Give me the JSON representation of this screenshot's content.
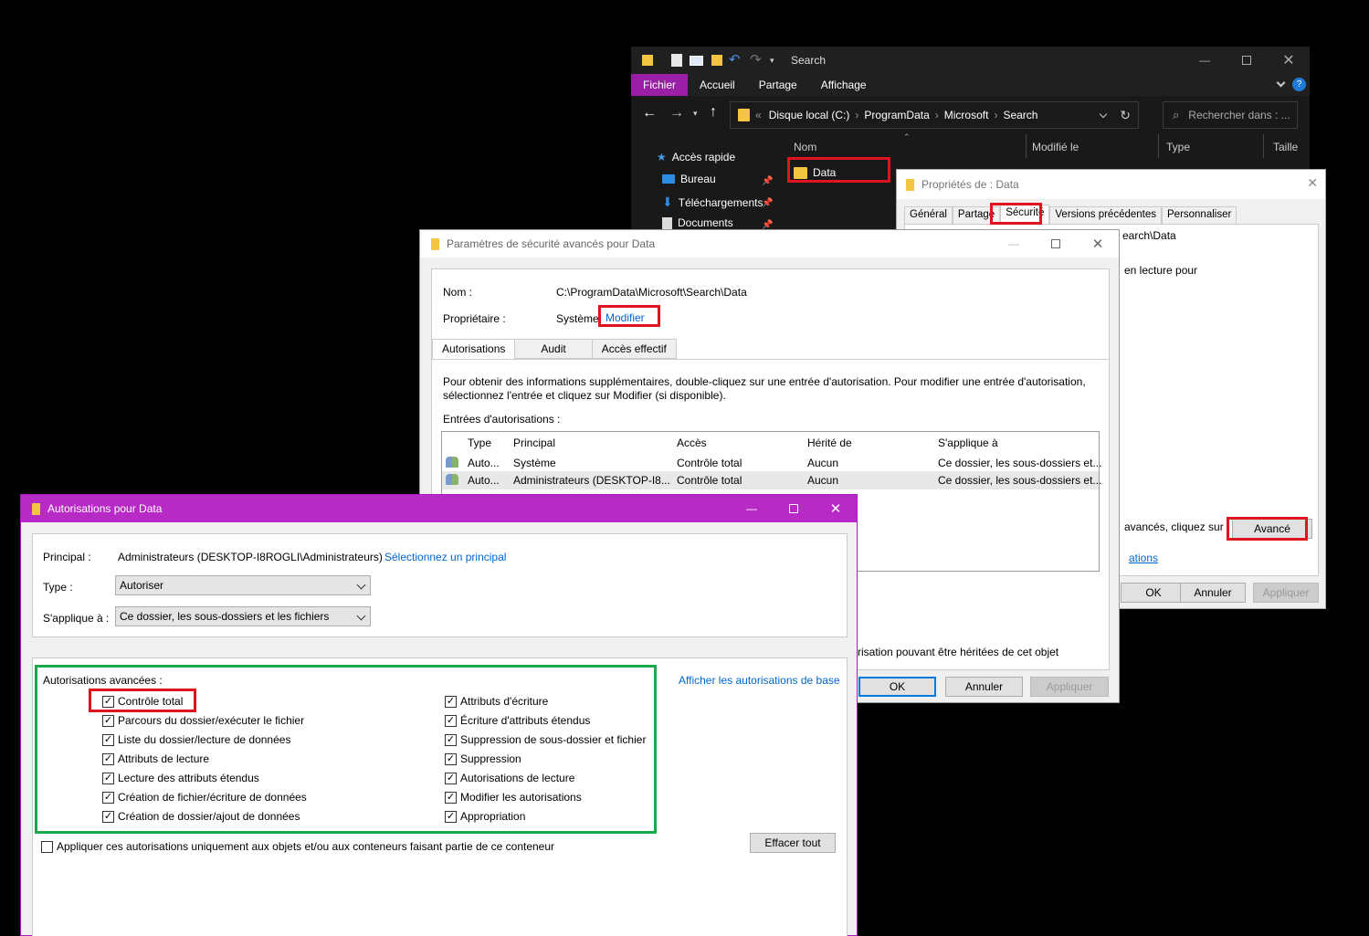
{
  "explorer": {
    "title": "Search",
    "ribbon_tabs": [
      "Fichier",
      "Accueil",
      "Partage",
      "Affichage"
    ],
    "address": [
      "Disque local (C:)",
      "ProgramData",
      "Microsoft",
      "Search"
    ],
    "address_prefix": "«",
    "search_placeholder": "Rechercher dans : ...",
    "nav": [
      "Accès rapide",
      "Bureau",
      "Téléchargements",
      "Documents"
    ],
    "columns": [
      "Nom",
      "Modifié le",
      "Type",
      "Taille"
    ],
    "file": "Data"
  },
  "props": {
    "title": "Propriétés de : Data",
    "tabs": [
      "Général",
      "Partage",
      "Sécurité",
      "Versions précédentes",
      "Personnaliser"
    ],
    "partial_path": "earch\\Data",
    "partial_read": "en lecture pour",
    "partial_adv": "avancés, cliquez sur",
    "advanced_button": "Avancé",
    "partial_link": "ations",
    "ok": "OK",
    "cancel": "Annuler",
    "apply": "Appliquer"
  },
  "adv": {
    "title": "Paramètres de sécurité avancés pour Data",
    "name_label": "Nom :",
    "name_value": "C:\\ProgramData\\Microsoft\\Search\\Data",
    "owner_label": "Propriétaire :",
    "owner_value": "Système",
    "owner_change": "Modifier",
    "tabs": [
      "Autorisations",
      "Audit",
      "Accès effectif"
    ],
    "info": "Pour obtenir des informations supplémentaires, double-cliquez sur une entrée d'autorisation. Pour modifier une entrée d'autorisation, sélectionnez l'entrée et cliquez sur Modifier (si disponible).",
    "entries_label": "Entrées d'autorisations :",
    "columns": [
      "Type",
      "Principal",
      "Accès",
      "Hérité de",
      "S'applique à"
    ],
    "rows": [
      [
        "Auto...",
        "Système",
        "Contrôle total",
        "Aucun",
        "Ce dossier, les sous-dossiers et..."
      ],
      [
        "Auto...",
        "Administrateurs (DESKTOP-I8...",
        "Contrôle total",
        "Aucun",
        "Ce dossier, les sous-dossiers et..."
      ]
    ],
    "partial_inherit": "risation pouvant être héritées de cet objet",
    "ok": "OK",
    "cancel": "Annuler",
    "apply": "Appliquer"
  },
  "perm": {
    "title": "Autorisations pour Data",
    "principal_label": "Principal :",
    "principal_value": "Administrateurs (DESKTOP-I8ROGLI\\Administrateurs)",
    "select_principal": "Sélectionnez un principal",
    "type_label": "Type :",
    "type_value": "Autoriser",
    "applies_label": "S'applique à :",
    "applies_value": "Ce dossier, les sous-dossiers et les fichiers",
    "advanced_label": "Autorisations avancées :",
    "show_basic": "Afficher les autorisations de base",
    "left_perms": [
      "Contrôle total",
      "Parcours du dossier/exécuter le fichier",
      "Liste du dossier/lecture de données",
      "Attributs de lecture",
      "Lecture des attributs étendus",
      "Création de fichier/écriture de données",
      "Création de dossier/ajout de données"
    ],
    "right_perms": [
      "Attributs d'écriture",
      "Écriture d'attributs étendus",
      "Suppression de sous-dossier et fichier",
      "Suppression",
      "Autorisations de lecture",
      "Modifier les autorisations",
      "Appropriation"
    ],
    "apply_only": "Appliquer ces autorisations uniquement aux objets et/ou aux conteneurs faisant partie de ce conteneur",
    "clear_all": "Effacer tout",
    "check_glyph": "✓"
  }
}
